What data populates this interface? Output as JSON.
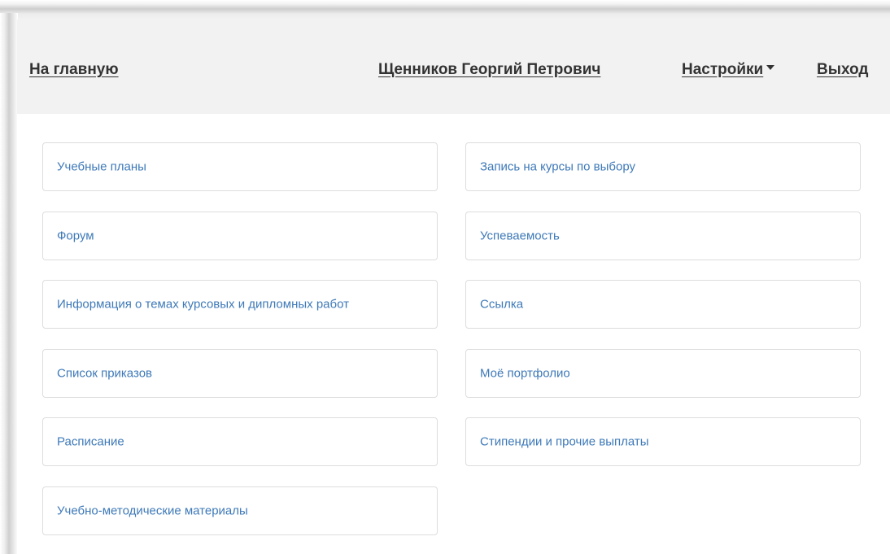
{
  "header": {
    "home_label": "На главную",
    "user_name": "Щенников Георгий Петрович",
    "settings_label": "Настройки",
    "logout_label": "Выход"
  },
  "menu": {
    "left": [
      "Учебные планы",
      "Форум",
      "Информация о темах курсовых и дипломных работ",
      "Список приказов",
      "Расписание",
      "Учебно-методические материалы"
    ],
    "right": [
      "Запись на курсы по выбору",
      "Успеваемость",
      "Ссылка",
      "Моё портфолио",
      "Стипендии и прочие выплаты"
    ]
  },
  "colors": {
    "header_background": "#f2f2f2",
    "nav_text": "#333333",
    "card_text": "#3e79b8",
    "card_border": "#dddddd"
  }
}
